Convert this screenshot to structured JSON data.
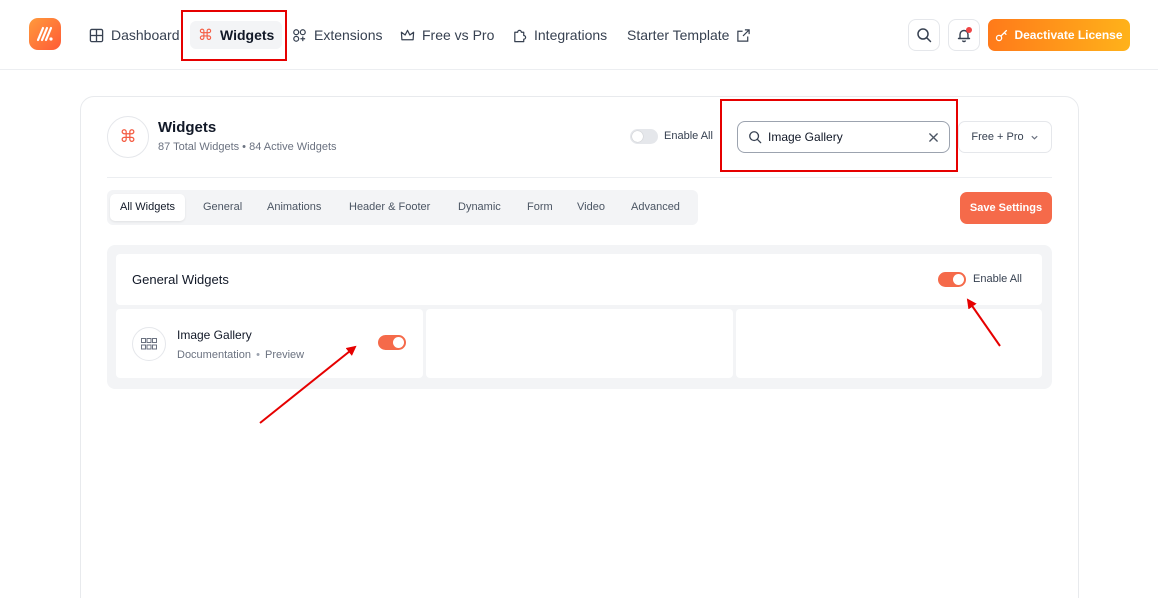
{
  "nav": {
    "items": [
      {
        "label": "Dashboard",
        "icon": "grid-icon"
      },
      {
        "label": "Widgets",
        "icon": "command-icon",
        "active": true
      },
      {
        "label": "Extensions",
        "icon": "extensions-icon"
      },
      {
        "label": "Free vs Pro",
        "icon": "crown-icon"
      },
      {
        "label": "Integrations",
        "icon": "puzzle-icon"
      },
      {
        "label": "Starter Template",
        "icon": "external-link-icon"
      }
    ],
    "license_button": "Deactivate License"
  },
  "header": {
    "title": "Widgets",
    "subtitle": "87 Total Widgets • 84 Active Widgets",
    "enable_all_label": "Enable All",
    "enable_all_on": false,
    "search": {
      "value": "Image Gallery"
    },
    "filter": {
      "selected": "Free + Pro"
    }
  },
  "tabs": [
    "All Widgets",
    "General",
    "Animations",
    "Header & Footer",
    "Dynamic",
    "Form",
    "Video",
    "Advanced"
  ],
  "save_button": "Save Settings",
  "section": {
    "title": "General Widgets",
    "enable_all_label": "Enable All",
    "enable_all_on": true,
    "widgets": [
      {
        "name": "Image Gallery",
        "doc_link": "Documentation",
        "separator": "•",
        "preview_link": "Preview",
        "enabled": true
      }
    ]
  },
  "colors": {
    "accent": "#f56a4a",
    "license_gradient_start": "#ff7a1a",
    "license_gradient_end": "#ffb21a",
    "annotation": "#e60000"
  }
}
